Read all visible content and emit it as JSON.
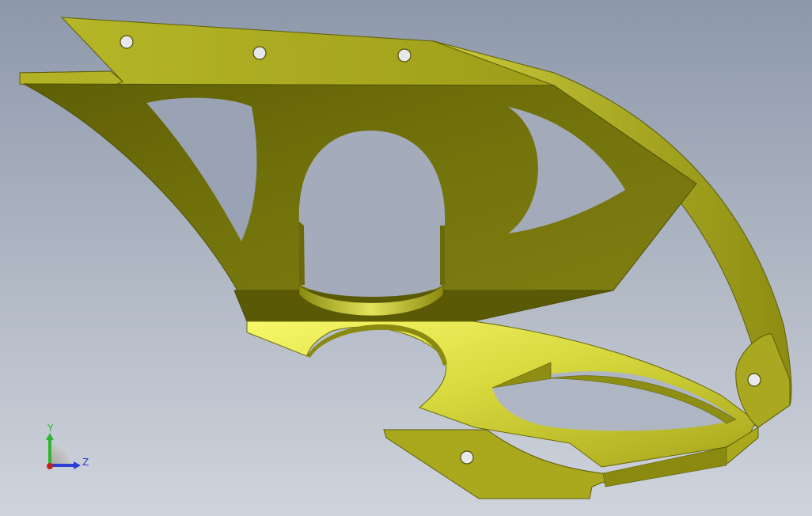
{
  "viewport": {
    "background_top": "#8d98aa",
    "background_bottom": "#cfd4dc",
    "part_name": "yellow-sheet-metal-bracket",
    "colors": {
      "part_light": "#eef060",
      "part_mid": "#a9a820",
      "part_dark": "#6f6f08",
      "part_shadow": "#55550a"
    }
  },
  "triad": {
    "y_label": "Y",
    "z_label": "Z",
    "y_color": "#2fb52f",
    "z_color": "#2b3fd0",
    "x_color": "#c42020"
  }
}
